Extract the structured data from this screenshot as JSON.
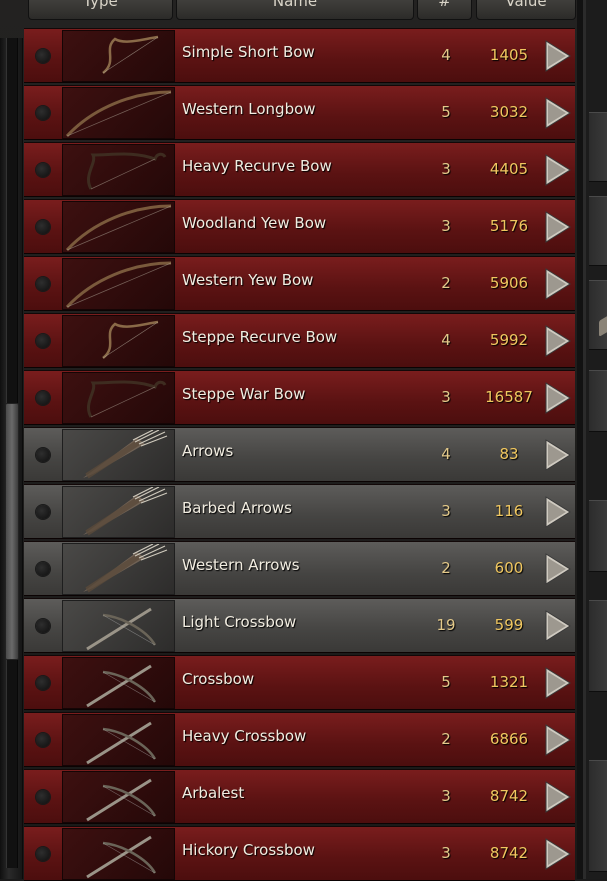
{
  "header": {
    "type_label": "Type",
    "name_label": "Name",
    "count_label": "#",
    "value_label": "Value"
  },
  "colors": {
    "row_bow": "#6a1818",
    "row_ammo": "#4e4d4b",
    "value_text": "#f0c760",
    "count_text": "#e3c98a"
  },
  "items": [
    {
      "name": "Simple Short Bow",
      "count": "4",
      "value": "1405",
      "icon": "short-bow-icon",
      "style": "red"
    },
    {
      "name": "Western Longbow",
      "count": "5",
      "value": "3032",
      "icon": "longbow-icon",
      "style": "red"
    },
    {
      "name": "Heavy Recurve Bow",
      "count": "3",
      "value": "4405",
      "icon": "recurve-bow-icon",
      "style": "red"
    },
    {
      "name": "Woodland Yew Bow",
      "count": "3",
      "value": "5176",
      "icon": "longbow-icon",
      "style": "red"
    },
    {
      "name": "Western Yew Bow",
      "count": "2",
      "value": "5906",
      "icon": "longbow-icon",
      "style": "red"
    },
    {
      "name": "Steppe Recurve Bow",
      "count": "4",
      "value": "5992",
      "icon": "short-bow-icon",
      "style": "red"
    },
    {
      "name": "Steppe War Bow",
      "count": "3",
      "value": "16587",
      "icon": "recurve-bow-icon",
      "style": "red"
    },
    {
      "name": "Arrows",
      "count": "4",
      "value": "83",
      "icon": "quiver-icon",
      "style": "gray"
    },
    {
      "name": "Barbed Arrows",
      "count": "3",
      "value": "116",
      "icon": "quiver-icon",
      "style": "gray"
    },
    {
      "name": "Western Arrows",
      "count": "2",
      "value": "600",
      "icon": "quiver-icon",
      "style": "gray"
    },
    {
      "name": "Light Crossbow",
      "count": "19",
      "value": "599",
      "icon": "crossbow-icon",
      "style": "gray"
    },
    {
      "name": "Crossbow",
      "count": "5",
      "value": "1321",
      "icon": "crossbow-icon",
      "style": "red"
    },
    {
      "name": "Heavy Crossbow",
      "count": "2",
      "value": "6866",
      "icon": "crossbow-icon",
      "style": "red"
    },
    {
      "name": "Arbalest",
      "count": "3",
      "value": "8742",
      "icon": "crossbow-icon",
      "style": "red"
    },
    {
      "name": "Hickory Crossbow",
      "count": "3",
      "value": "8742",
      "icon": "crossbow-icon",
      "style": "red"
    }
  ]
}
